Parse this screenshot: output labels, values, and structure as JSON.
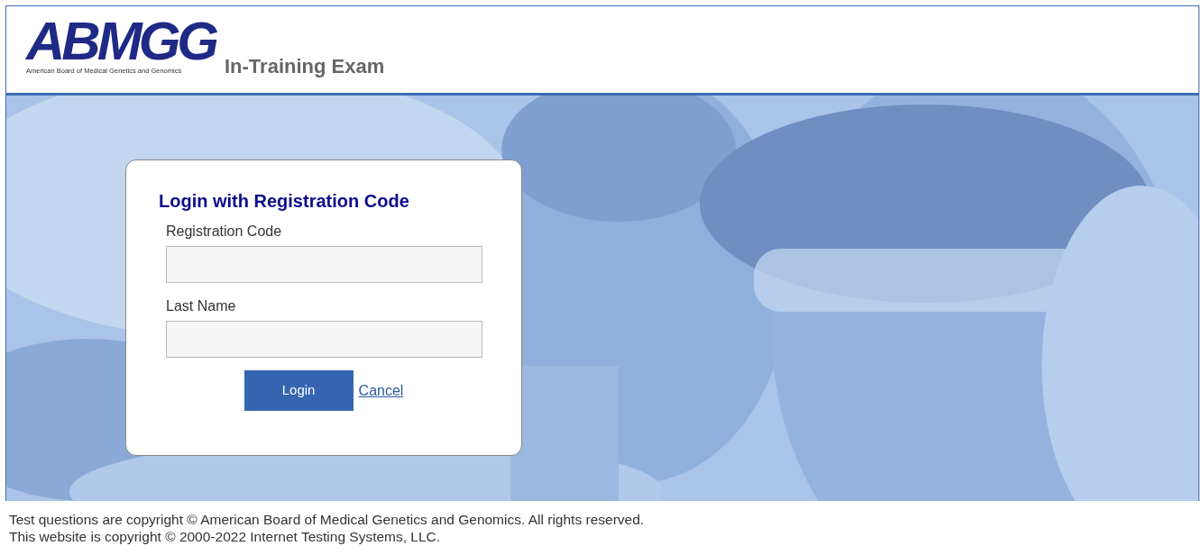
{
  "header": {
    "logo_text": "ABMGG",
    "logo_subtitle": "American Board of Medical Genetics and Genomics",
    "title": "In-Training Exam"
  },
  "login": {
    "title": "Login with Registration Code",
    "fields": [
      {
        "label": "Registration Code"
      },
      {
        "label": "Last Name"
      }
    ],
    "buttons": [
      {
        "kind": "primary",
        "label": "Login"
      },
      {
        "kind": "link",
        "label": "Cancel"
      }
    ]
  },
  "footer": {
    "lines": [
      "Test questions are copyright © American Board of Medical Genetics and Genomics. All rights reserved.",
      "This website is copyright © 2000-2022 Internet Testing Systems, LLC."
    ]
  }
}
